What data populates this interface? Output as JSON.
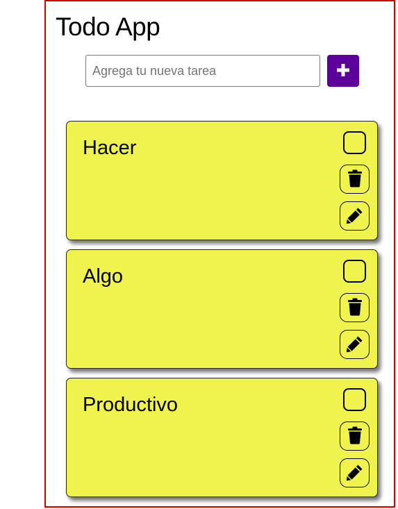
{
  "app": {
    "title": "Todo App"
  },
  "new_task": {
    "placeholder": "Agrega tu nueva tarea",
    "value": "",
    "add_icon": "plus-icon"
  },
  "tasks": [
    {
      "text": "Hacer",
      "done": false,
      "delete_icon": "trash-icon",
      "edit_icon": "pencil-icon"
    },
    {
      "text": "Algo",
      "done": false,
      "delete_icon": "trash-icon",
      "edit_icon": "pencil-icon"
    },
    {
      "text": "Productivo",
      "done": false,
      "delete_icon": "trash-icon",
      "edit_icon": "pencil-icon"
    }
  ],
  "colors": {
    "frame_border": "#d40000",
    "accent": "#5c0099",
    "card_background": "#f0f24e",
    "text": "#000000"
  }
}
